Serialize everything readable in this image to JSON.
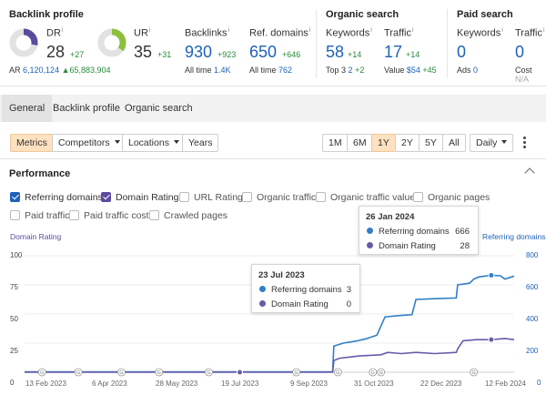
{
  "backlink_profile": {
    "title": "Backlink profile",
    "dr": {
      "label": "DR",
      "value": "28",
      "delta": "+27",
      "fill": 0.28
    },
    "ar": {
      "label": "AR",
      "value": "6,120,124",
      "delta": "▲65,883,904"
    },
    "ur": {
      "label": "UR",
      "value": "35",
      "delta": "+31",
      "fill": 0.35
    },
    "backlinks": {
      "label": "Backlinks",
      "value": "930",
      "delta": "+923",
      "sub_label": "All time",
      "sub_value": "1.4K"
    },
    "ref_domains": {
      "label": "Ref. domains",
      "value": "650",
      "delta": "+646",
      "sub_label": "All time",
      "sub_value": "762"
    }
  },
  "organic_search": {
    "title": "Organic search",
    "keywords": {
      "label": "Keywords",
      "value": "58",
      "delta": "+14",
      "sub_label": "Top 3",
      "sub_value": "2",
      "sub_delta": "+2"
    },
    "traffic": {
      "label": "Traffic",
      "value": "17",
      "delta": "+14",
      "sub_label": "Value",
      "sub_value": "$54",
      "sub_delta": "+45"
    }
  },
  "paid_search": {
    "title": "Paid search",
    "keywords": {
      "label": "Keywords",
      "value": "0",
      "sub_label": "Ads",
      "sub_value": "0"
    },
    "traffic": {
      "label": "Traffic",
      "value": "0",
      "sub_label": "Cost",
      "sub_value": "N/A"
    }
  },
  "info_mark": "i",
  "tabs": [
    "General",
    "Backlink profile",
    "Organic search"
  ],
  "toolbar": {
    "metrics": "Metrics",
    "competitors": "Competitors",
    "locations": "Locations",
    "years": "Years",
    "ranges": [
      "1M",
      "6M",
      "1Y",
      "2Y",
      "5Y",
      "All"
    ],
    "active_range": "1Y",
    "interval": "Daily"
  },
  "performance": {
    "title": "Performance",
    "checkboxes": [
      {
        "label": "Referring domains",
        "checked": true,
        "color": "#1e62b8"
      },
      {
        "label": "Domain Rating",
        "checked": true,
        "color": "#5b4a9e"
      },
      {
        "label": "URL Rating",
        "checked": false
      },
      {
        "label": "Organic traffic",
        "checked": false
      },
      {
        "label": "Organic traffic value",
        "checked": false
      },
      {
        "label": "Organic pages",
        "checked": false
      },
      {
        "label": "Paid traffic",
        "checked": false
      },
      {
        "label": "Paid traffic cost",
        "checked": false
      },
      {
        "label": "Crawled pages",
        "checked": false
      }
    ]
  },
  "tooltips": [
    {
      "date": "26 Jan 2024",
      "rows": [
        {
          "label": "Referring domains",
          "value": "666"
        },
        {
          "label": "Domain Rating",
          "value": "28"
        }
      ]
    },
    {
      "date": "23 Jul 2023",
      "rows": [
        {
          "label": "Referring domains",
          "value": "3"
        },
        {
          "label": "Domain Rating",
          "value": "0"
        }
      ]
    }
  ],
  "colors": {
    "ref_domains": "#2f7fc8",
    "domain_rating": "#6b5aa8",
    "accent": "#fde1c0"
  },
  "chart_data": {
    "type": "line",
    "left_axis": {
      "title": "Domain Rating",
      "ticks": [
        "100",
        "75",
        "50",
        "25",
        "0"
      ],
      "range": [
        0,
        100
      ]
    },
    "right_axis": {
      "title": "Referring domains",
      "ticks": [
        "800",
        "600",
        "400",
        "200",
        "0"
      ],
      "range": [
        0,
        800
      ]
    },
    "x_ticks": [
      "13 Feb 2023",
      "6 Apr 2023",
      "28 May 2023",
      "19 Jul 2023",
      "9 Sep 2023",
      "31 Oct 2023",
      "22 Dec 2023",
      "12 Feb 2024"
    ],
    "x_range": [
      "2023-02-13",
      "2024-02-12"
    ],
    "series": [
      {
        "name": "Referring domains",
        "axis": "right",
        "points": [
          [
            "2023-02-13",
            3
          ],
          [
            "2023-07-23",
            3
          ],
          [
            "2023-09-30",
            3
          ],
          [
            "2023-10-01",
            180
          ],
          [
            "2023-10-08",
            200
          ],
          [
            "2023-10-18",
            215
          ],
          [
            "2023-10-25",
            230
          ],
          [
            "2023-11-02",
            255
          ],
          [
            "2023-11-08",
            380
          ],
          [
            "2023-11-20",
            390
          ],
          [
            "2023-11-28",
            395
          ],
          [
            "2023-12-01",
            500
          ],
          [
            "2023-12-15",
            505
          ],
          [
            "2023-12-31",
            510
          ],
          [
            "2024-01-01",
            600
          ],
          [
            "2024-01-10",
            612
          ],
          [
            "2024-01-13",
            640
          ],
          [
            "2024-01-17",
            655
          ],
          [
            "2024-01-26",
            666
          ],
          [
            "2024-02-02",
            662
          ],
          [
            "2024-02-05",
            640
          ],
          [
            "2024-02-08",
            648
          ],
          [
            "2024-02-12",
            660
          ]
        ]
      },
      {
        "name": "Domain Rating",
        "axis": "left",
        "points": [
          [
            "2023-02-13",
            0
          ],
          [
            "2023-07-23",
            0
          ],
          [
            "2023-09-30",
            0
          ],
          [
            "2023-10-01",
            10
          ],
          [
            "2023-10-05",
            12
          ],
          [
            "2023-10-12",
            13
          ],
          [
            "2023-10-20",
            14
          ],
          [
            "2023-11-05",
            15
          ],
          [
            "2023-11-10",
            17
          ],
          [
            "2023-11-20",
            16
          ],
          [
            "2023-12-01",
            17
          ],
          [
            "2023-12-15",
            16
          ],
          [
            "2023-12-31",
            17
          ],
          [
            "2024-01-01",
            20
          ],
          [
            "2024-01-05",
            27
          ],
          [
            "2024-01-15",
            28
          ],
          [
            "2024-01-26",
            28
          ],
          [
            "2024-02-05",
            29
          ],
          [
            "2024-02-12",
            28
          ]
        ]
      }
    ],
    "annotation_markers": [
      "2023-02-26",
      "2023-03-25",
      "2023-04-26",
      "2023-05-24",
      "2023-06-30",
      "2023-09-03",
      "2023-10-04",
      "2023-10-30",
      "2023-11-05",
      "2024-01-13"
    ],
    "grid": true
  }
}
